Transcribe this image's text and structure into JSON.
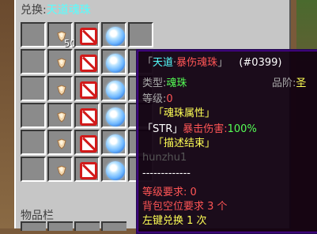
{
  "title": {
    "prefix": "兑换",
    "separator": ":",
    "name": "天道魂珠"
  },
  "inventory_label": "物品栏",
  "slot_count": "50",
  "tooltip": {
    "header_open": "「",
    "header_series": "天道",
    "header_dot": "·",
    "header_name": "暴伤魂珠",
    "header_close": "」",
    "item_id": "(#0399)",
    "type_label": "类型:",
    "type_value": "魂珠",
    "grade_label": "品阶:",
    "grade_value": "圣",
    "level_label": "等级:",
    "level_value": "0",
    "attr_section": "「魂珠属性」",
    "attr_key": "「STR」",
    "attr_name": "暴击伤害:",
    "attr_value": "100%",
    "end_section": "「描述结束」",
    "author": "hunzhu1",
    "divider": "-------------",
    "req_level": "等级要求: 0",
    "req_slots": "背包空位要求 3 个",
    "action": "左键兑换 1 次"
  },
  "colors": {
    "panel": "#c6c6c6",
    "slot": "#8b8b8b",
    "cyan": "#55ffff",
    "red": "#ff5555",
    "green": "#55ff55",
    "yellow": "#ffff55"
  }
}
